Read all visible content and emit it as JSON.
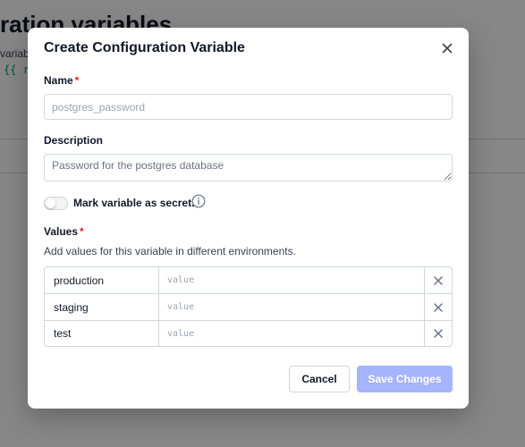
{
  "background": {
    "title": "ration variables",
    "description": "variab",
    "code": "{{ r"
  },
  "modal": {
    "title": "Create Configuration Variable",
    "name": {
      "label": "Name",
      "required_mark": "*",
      "placeholder": "postgres_password",
      "value": ""
    },
    "description": {
      "label": "Description",
      "placeholder": "Password for the postgres database",
      "value": ""
    },
    "secret_toggle": {
      "label": "Mark variable as secret.",
      "checked": false
    },
    "values": {
      "label": "Values",
      "required_mark": "*",
      "help_text": "Add values for this variable in different environments.",
      "value_placeholder": "value",
      "rows": [
        {
          "environment": "production",
          "value": ""
        },
        {
          "environment": "staging",
          "value": ""
        },
        {
          "environment": "test",
          "value": ""
        }
      ]
    },
    "buttons": {
      "cancel": "Cancel",
      "save": "Save Changes"
    }
  },
  "colors": {
    "overlay": "rgba(0,0,0,0.47)",
    "primary_disabled": "#a5b4fc",
    "required": "#dc2626",
    "code": "#059669"
  },
  "icons": {
    "close": "close-icon",
    "info": "info-icon",
    "remove": "remove-row-icon"
  }
}
